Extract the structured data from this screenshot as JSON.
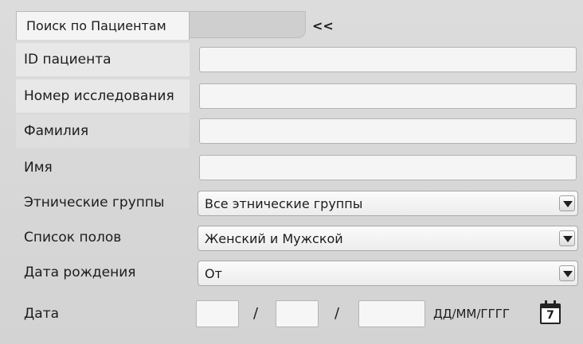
{
  "tabs": {
    "active_label": "Поиск по Пациентам",
    "collapse_label": "<<"
  },
  "fields": {
    "patient_id": {
      "label": "ID пациента",
      "value": ""
    },
    "study_number": {
      "label": "Номер исследования",
      "value": ""
    },
    "last_name": {
      "label": "Фамилия",
      "value": ""
    },
    "first_name": {
      "label": "Имя",
      "value": ""
    }
  },
  "selects": {
    "ethnic_groups": {
      "label": "Этнические группы",
      "value": "Все этнические группы"
    },
    "gender_list": {
      "label": "Список полов",
      "value": "Женский и Мужской"
    },
    "birth_date": {
      "label": "Дата рождения",
      "value": "От"
    }
  },
  "date": {
    "label": "Дата",
    "separator": "/",
    "format": "ДД/ММ/ГГГГ",
    "calendar_day": "7",
    "day": "",
    "month": "",
    "year": ""
  },
  "icons": {
    "dropdown": "chevron-down-icon",
    "calendar": "calendar-icon"
  }
}
